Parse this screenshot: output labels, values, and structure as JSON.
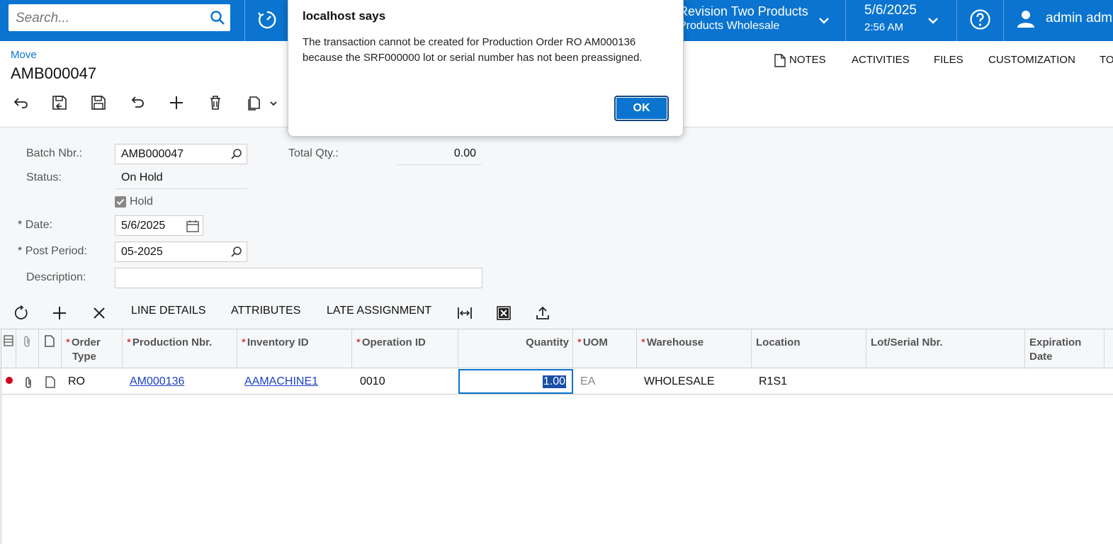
{
  "topbar": {
    "search_placeholder": "Search...",
    "company_line1": "Revision Two Products",
    "company_line2": "Products Wholesale",
    "date": "5/6/2025",
    "time": "2:56 AM",
    "user": "admin admin"
  },
  "page": {
    "breadcrumb": "Move",
    "title": "AMB000047",
    "menu": [
      "NOTES",
      "ACTIVITIES",
      "FILES",
      "CUSTOMIZATION",
      "TOOLS"
    ]
  },
  "form": {
    "batch_label": "Batch Nbr.:",
    "batch_value": "AMB000047",
    "status_label": "Status:",
    "status_value": "On Hold",
    "hold_label": "Hold",
    "date_label": "Date:",
    "date_value": "5/6/2025",
    "post_period_label": "Post Period:",
    "post_period_value": "05-2025",
    "description_label": "Description:",
    "description_value": "",
    "total_qty_label": "Total Qty.:",
    "total_qty_value": "0.00",
    "required_mark": "*"
  },
  "grid_toolbar": {
    "line_details": "LINE DETAILS",
    "attributes": "ATTRIBUTES",
    "late_assignment": "LATE ASSIGNMENT"
  },
  "grid": {
    "headers": {
      "order_type_1": "Order",
      "order_type_2": "Type",
      "production_nbr": "Production Nbr.",
      "inventory_id": "Inventory ID",
      "operation_id": "Operation ID",
      "quantity": "Quantity",
      "uom": "UOM",
      "warehouse": "Warehouse",
      "location": "Location",
      "lot_serial": "Lot/Serial Nbr.",
      "expiration_1": "Expiration",
      "expiration_2": "Date"
    },
    "row": {
      "order_type": "RO",
      "production_nbr": "AM000136",
      "inventory_id": "AAMACHINE1",
      "operation_id": "0010",
      "quantity": "1.00",
      "uom": "EA",
      "warehouse": "WHOLESALE",
      "location": "R1S1",
      "lot_serial": "",
      "expiration": ""
    }
  },
  "dialog": {
    "title": "localhost says",
    "message": "The transaction cannot be created for Production Order RO AM000136 because the SRF000000 lot or serial number has not been preassigned.",
    "ok_label": "OK"
  },
  "colors": {
    "brand": "#0a74d0",
    "error_dot": "#d0021b"
  }
}
